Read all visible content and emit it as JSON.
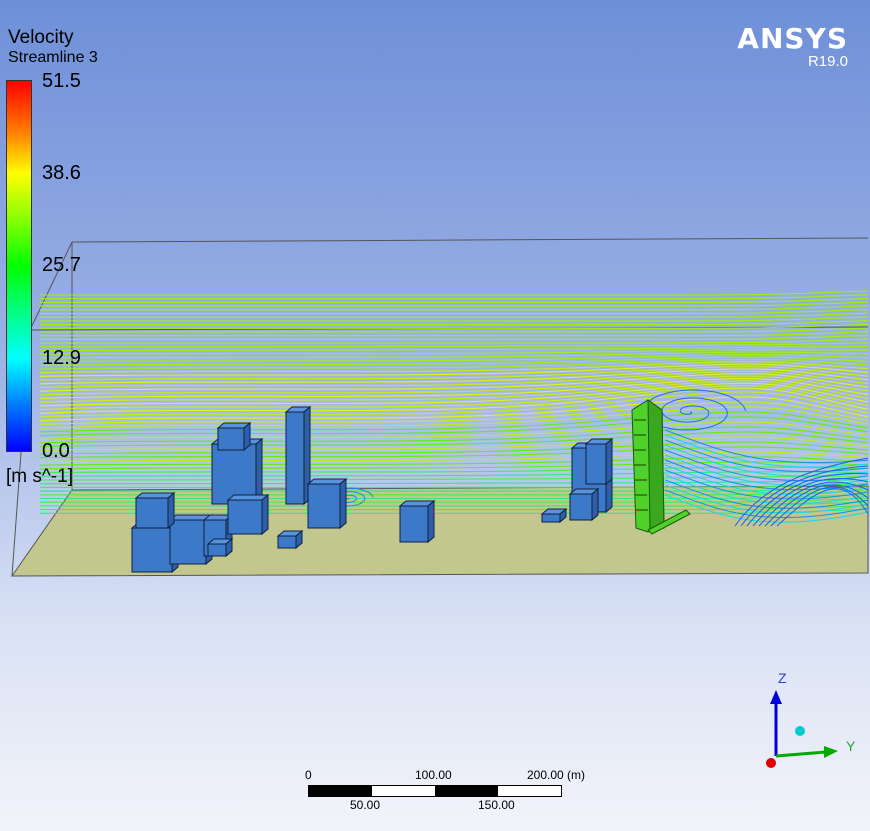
{
  "legend": {
    "title": "Velocity",
    "subtitle": "Streamline 3",
    "ticks": [
      "51.5",
      "38.6",
      "25.7",
      "12.9",
      "0.0"
    ],
    "units": "[m s^-1]",
    "colors": [
      "#ff0000",
      "#ffff00",
      "#00ff00",
      "#00ffff",
      "#0000ff"
    ]
  },
  "brand": {
    "name": "ANSYS",
    "version": "R19.0"
  },
  "scale_bar": {
    "top_labels": [
      "0",
      "100.00",
      "200.00  (m)"
    ],
    "bottom_labels": [
      "50.00",
      "150.00"
    ]
  },
  "axes": {
    "z": "Z",
    "y": "Y"
  },
  "colors": {
    "ground": "#c2c78e",
    "building": "#3d79c9",
    "tower": "#4fd12a",
    "domain_edge": "#444444"
  }
}
